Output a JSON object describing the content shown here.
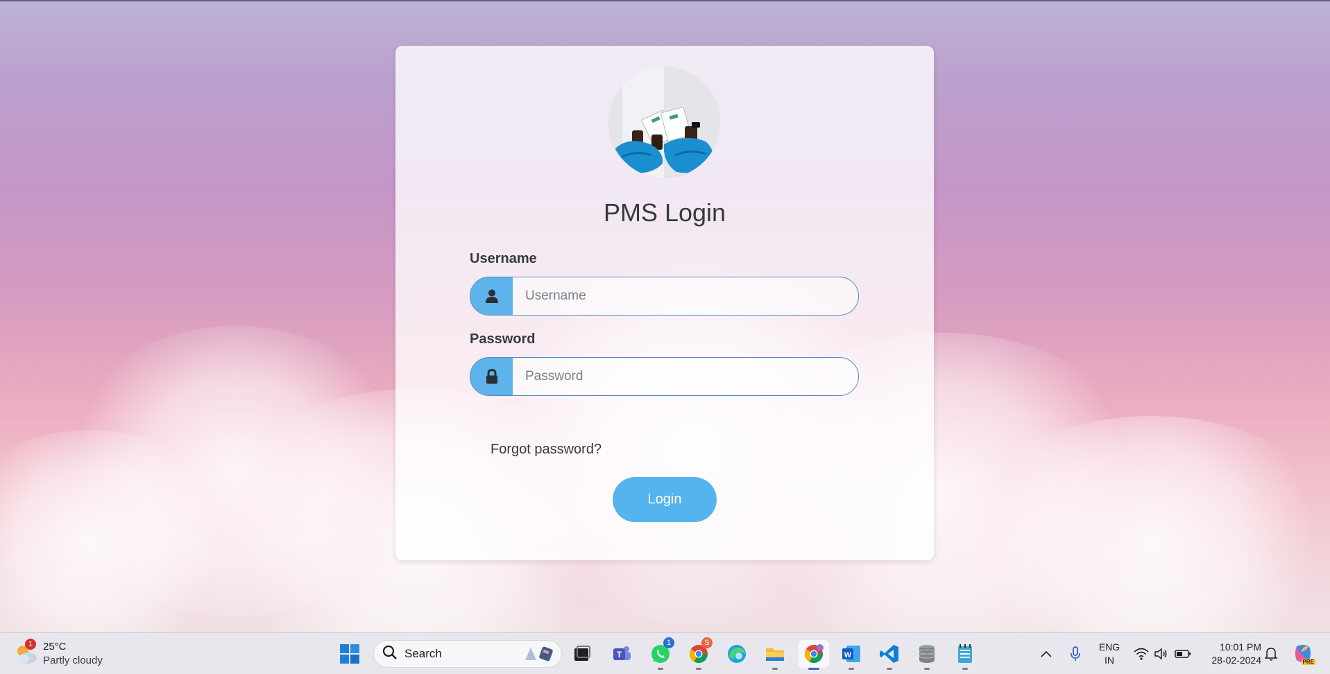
{
  "login": {
    "title": "PMS Login",
    "username_label": "Username",
    "username_placeholder": "Username",
    "username_value": "",
    "password_label": "Password",
    "password_placeholder": "Password",
    "password_value": "",
    "forgot_link": "Forgot password?",
    "login_button": "Login",
    "addon_color": "#5db3ea",
    "button_color": "#55b3ee"
  },
  "taskbar": {
    "weather": {
      "temperature": "25°C",
      "condition": "Partly cloudy",
      "badge": "1"
    },
    "search_label": "Search",
    "apps": [
      {
        "name": "start-icon"
      },
      {
        "name": "task-view-icon"
      },
      {
        "name": "teams-icon"
      },
      {
        "name": "whatsapp-icon",
        "badge": "1"
      },
      {
        "name": "chrome-icon",
        "badge": "S"
      },
      {
        "name": "edge-icon"
      },
      {
        "name": "file-explorer-icon"
      },
      {
        "name": "chrome-profile-icon"
      },
      {
        "name": "word-icon"
      },
      {
        "name": "vscode-icon"
      },
      {
        "name": "database-icon"
      },
      {
        "name": "notepad-icon"
      }
    ],
    "language": {
      "line1": "ENG",
      "line2": "IN"
    },
    "clock": {
      "time": "10:01 PM",
      "date": "28-02-2024"
    },
    "copilot_badge": "PRE"
  }
}
